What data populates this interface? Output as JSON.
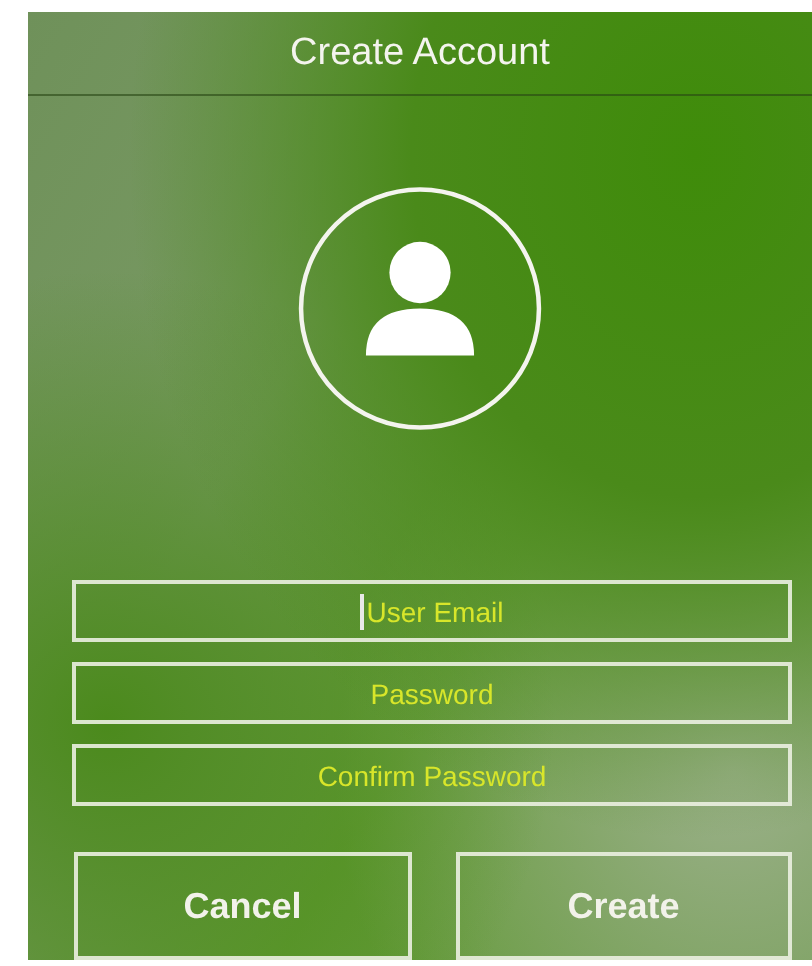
{
  "window": {
    "title": "Create Account"
  },
  "fields": [
    {
      "placeholder": "User Email",
      "focused": true
    },
    {
      "placeholder": "Password",
      "focused": false
    },
    {
      "placeholder": "Confirm Password",
      "focused": false
    }
  ],
  "buttons": [
    "Cancel",
    "Create"
  ]
}
